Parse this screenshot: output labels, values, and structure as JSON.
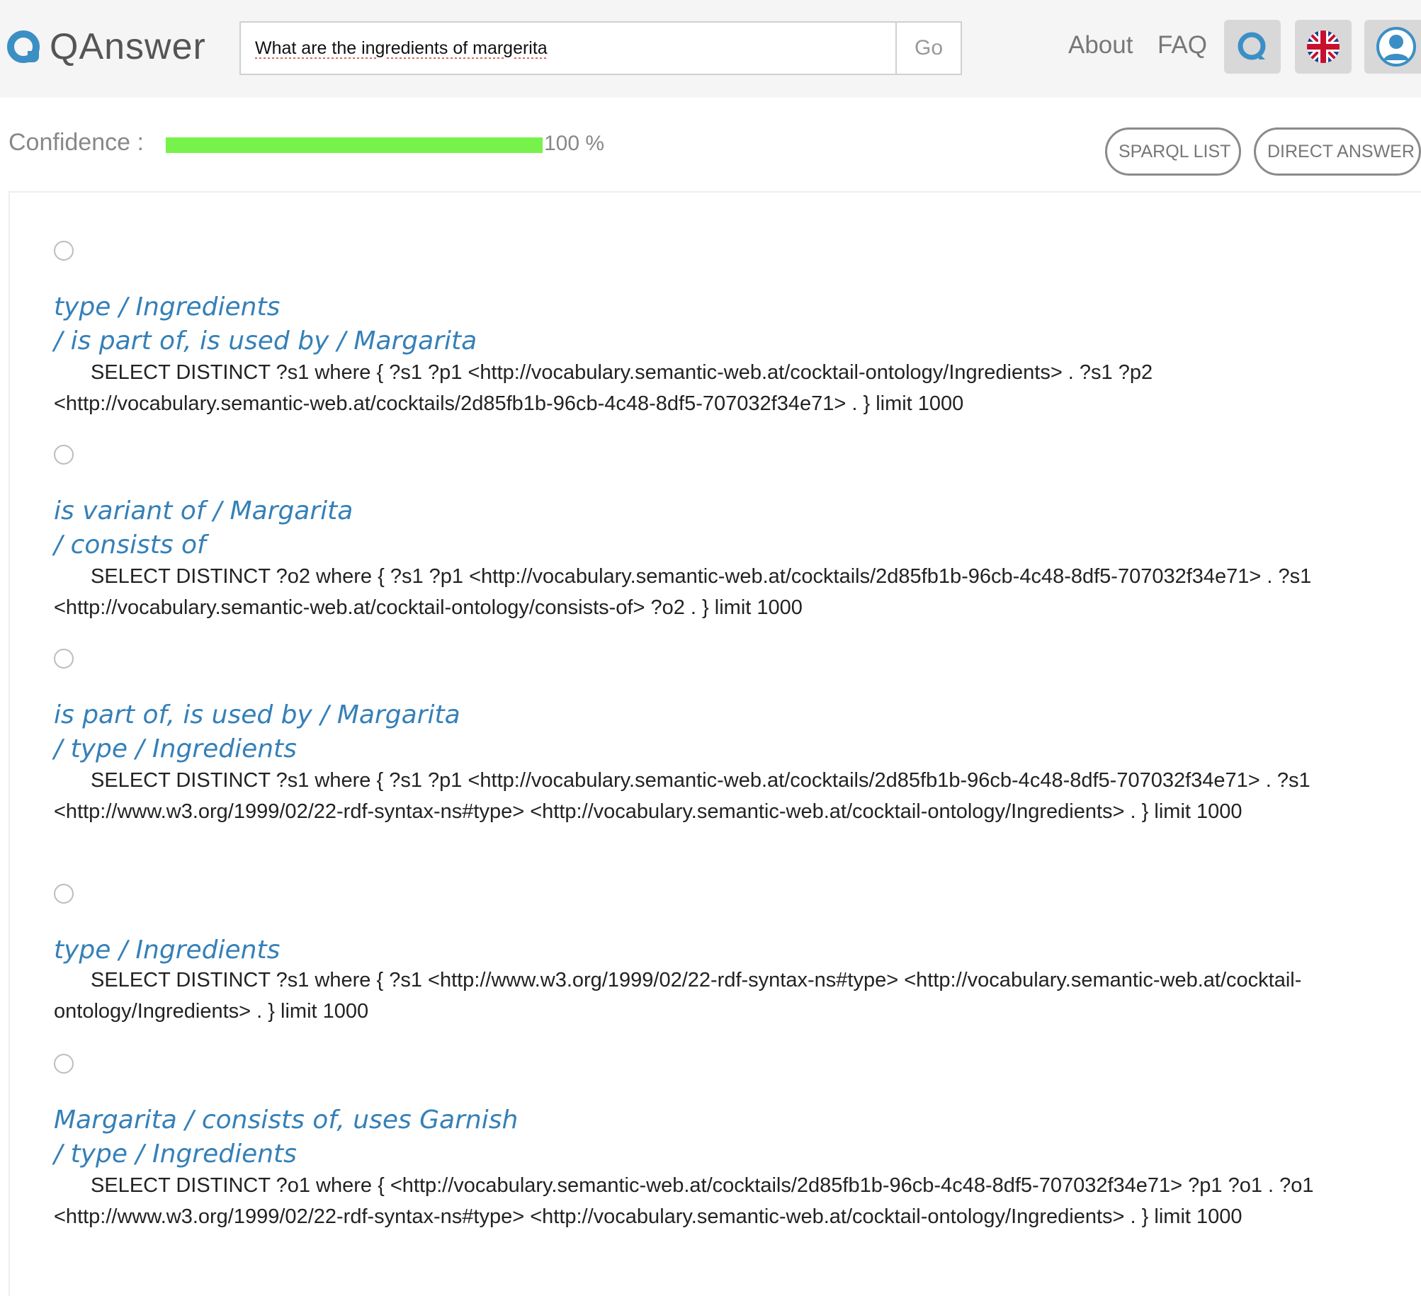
{
  "header": {
    "logo_text": "QAnswer",
    "search": {
      "value": "What are the ingredients of margerita",
      "placeholder": ""
    },
    "go_label": "Go",
    "nav": {
      "about": "About",
      "faq": "FAQ"
    }
  },
  "confidence": {
    "label": "Confidence :",
    "value": 1.0,
    "text": "100 %",
    "bar_color": "#77f24a"
  },
  "buttons": {
    "sparql_list": "SPARQL LIST",
    "direct_answer": "DIRECT ANSWER"
  },
  "colors": {
    "accent": "#3580b8",
    "logo": "#3b8fc5"
  },
  "icons": {
    "qa_button": "qanswer-logo-icon",
    "language": "uk-flag-icon",
    "user": "user-avatar-icon"
  },
  "results": [
    {
      "title": "type / Ingredients\n / is part of, is used by / Margarita",
      "query": "SELECT DISTINCT ?s1 where { ?s1 ?p1 <http://vocabulary.semantic-web.at/cocktail-ontology/Ingredients> . ?s1 ?p2 <http://vocabulary.semantic-web.at/cocktails/2d85fb1b-96cb-4c48-8df5-707032f34e71> . } limit 1000"
    },
    {
      "title": "is variant of / Margarita\n / consists of",
      "query": "SELECT DISTINCT ?o2 where { ?s1 ?p1 <http://vocabulary.semantic-web.at/cocktails/2d85fb1b-96cb-4c48-8df5-707032f34e71> . ?s1 <http://vocabulary.semantic-web.at/cocktail-ontology/consists-of> ?o2 . } limit 1000"
    },
    {
      "title": "is part of, is used by / Margarita\n / type / Ingredients",
      "query": "SELECT DISTINCT ?s1 where { ?s1 ?p1 <http://vocabulary.semantic-web.at/cocktails/2d85fb1b-96cb-4c48-8df5-707032f34e71> . ?s1 <http://www.w3.org/1999/02/22-rdf-syntax-ns#type> <http://vocabulary.semantic-web.at/cocktail-ontology/Ingredients> . } limit 1000"
    },
    {
      "title": "type / Ingredients",
      "query": "SELECT DISTINCT ?s1 where { ?s1 <http://www.w3.org/1999/02/22-rdf-syntax-ns#type> <http://vocabulary.semantic-web.at/cocktail-ontology/Ingredients> . } limit 1000"
    },
    {
      "title": "Margarita / consists of, uses Garnish\n / type / Ingredients",
      "query": "SELECT DISTINCT ?o1 where { <http://vocabulary.semantic-web.at/cocktails/2d85fb1b-96cb-4c48-8df5-707032f34e71> ?p1 ?o1 . ?o1 <http://www.w3.org/1999/02/22-rdf-syntax-ns#type> <http://vocabulary.semantic-web.at/cocktail-ontology/Ingredients> . } limit 1000"
    }
  ]
}
